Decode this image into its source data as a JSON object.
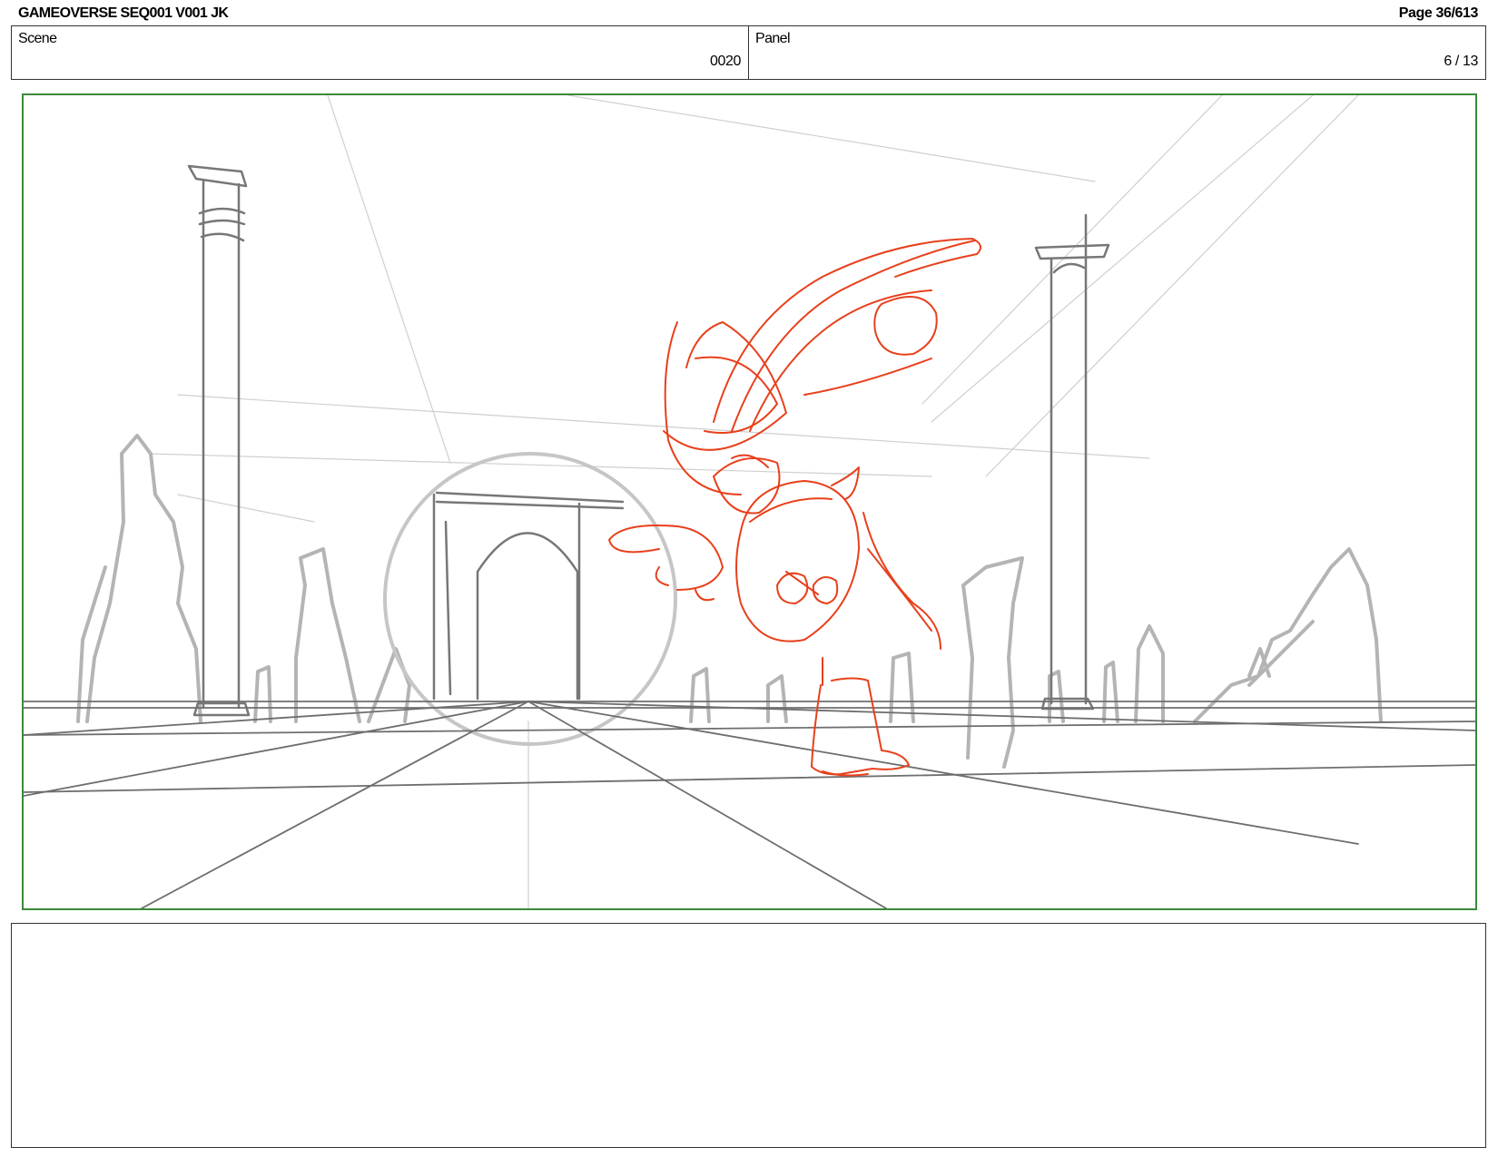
{
  "header": {
    "document_title": "GAMEOVERSE SEQ001 V001 JK",
    "page_label": "Page  36/613"
  },
  "scene": {
    "label": "Scene",
    "value": "0020"
  },
  "panel": {
    "label": "Panel",
    "value": "6 / 13"
  },
  "sketch": {
    "frame_color": "#3a8a3a",
    "character_color": "#e8401c",
    "background_color": "#9a9a9a"
  },
  "notes": {
    "text": ""
  }
}
